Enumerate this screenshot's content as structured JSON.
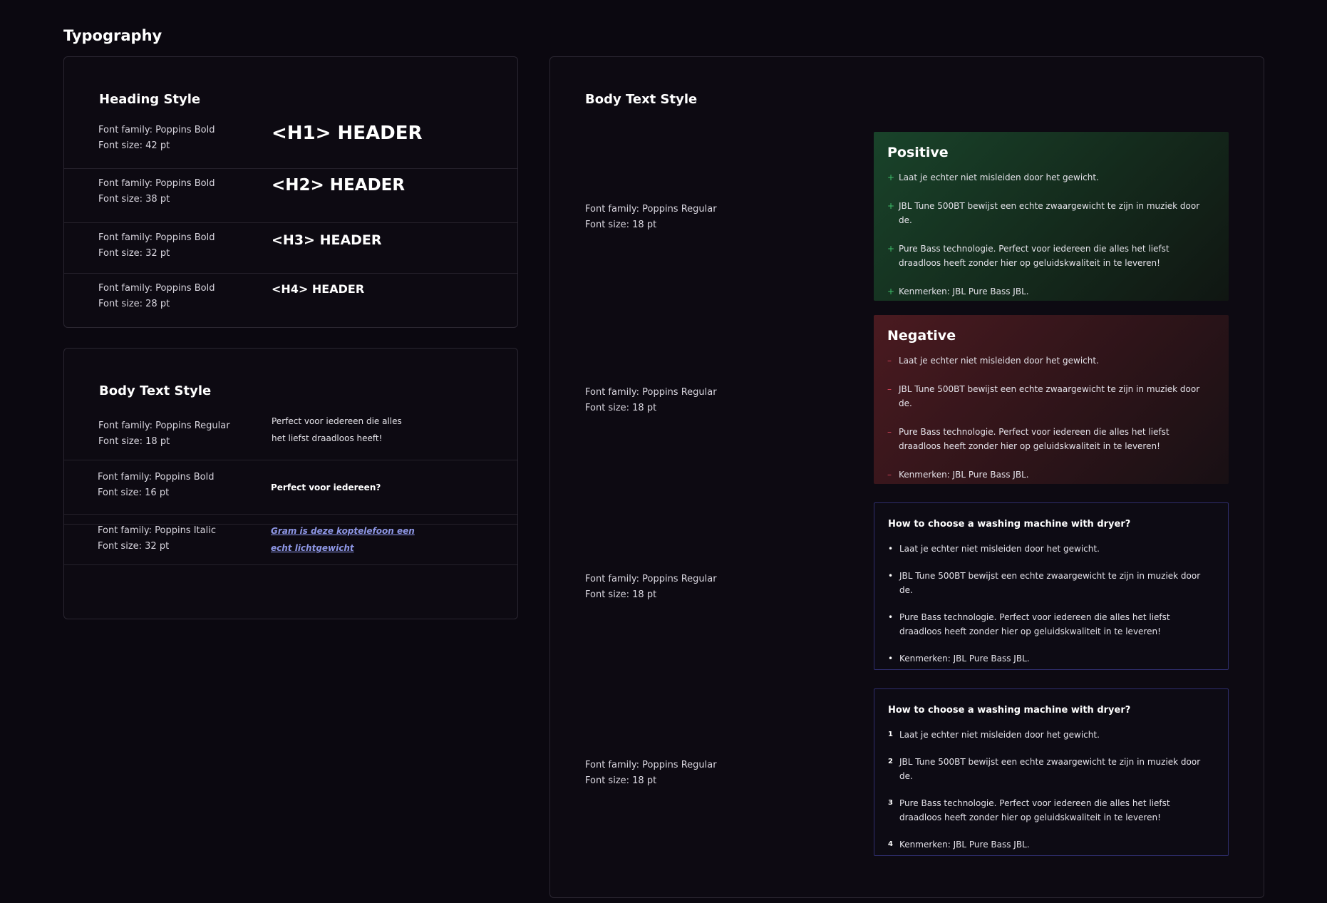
{
  "page": {
    "title": "Typography"
  },
  "heading_panel": {
    "title": "Heading Style",
    "rows": [
      {
        "family": "Font family: Poppins Bold",
        "size": "Font size: 42 pt",
        "sample": "<H1> HEADER"
      },
      {
        "family": "Font family: Poppins Bold",
        "size": "Font size: 38 pt",
        "sample": "<H2> HEADER"
      },
      {
        "family": "Font family: Poppins Bold",
        "size": "Font size: 32 pt",
        "sample": "<H3> HEADER"
      },
      {
        "family": "Font family: Poppins Bold",
        "size": "Font size: 28 pt",
        "sample": "<H4> HEADER"
      }
    ]
  },
  "body_panel": {
    "title": "Body Text Style",
    "rows": [
      {
        "family": "Font family: Poppins Regular",
        "size": "Font size: 18 pt",
        "sample_line1": "Perfect voor iedereen die alles",
        "sample_line2": "het liefst draadloos heeft!"
      },
      {
        "family": "Font family: Poppins Bold",
        "size": "Font size: 16 pt",
        "sample": "Perfect voor iedereen?"
      },
      {
        "family": "Font family: Poppins Italic",
        "size": "Font size: 32 pt",
        "sample_line1": "Gram is deze koptelefoon een",
        "sample_line2": "echt lichtgewicht"
      }
    ]
  },
  "right_panel": {
    "title": "Body Text Style",
    "sections": [
      {
        "family": "Font family: Poppins Regular",
        "size": "Font size: 18 pt",
        "card_title": "Positive",
        "items": [
          "Laat je echter niet misleiden door het gewicht.",
          "JBL Tune 500BT bewijst een echte zwaargewicht te zijn in muziek door de.",
          "Pure Bass technologie. Perfect voor iedereen die alles het liefst draadloos heeft zonder hier op geluidskwaliteit in te leveren!",
          "Kenmerken: JBL Pure Bass JBL."
        ],
        "marker": "+"
      },
      {
        "family": "Font family: Poppins Regular",
        "size": "Font size: 18 pt",
        "card_title": "Negative",
        "items": [
          "Laat je echter niet misleiden door het gewicht.",
          "JBL Tune 500BT bewijst een echte zwaargewicht te zijn in muziek door de.",
          "Pure Bass technologie. Perfect voor iedereen die alles het liefst draadloos heeft zonder hier op geluidskwaliteit in te leveren!",
          "Kenmerken: JBL Pure Bass JBL."
        ],
        "marker": "–"
      },
      {
        "family": "Font family: Poppins Regular",
        "size": "Font size: 18 pt",
        "card_title": "How to choose a washing machine with dryer?",
        "items": [
          "Laat je echter niet misleiden door het gewicht.",
          "JBL Tune 500BT bewijst een echte zwaargewicht te zijn in muziek door de.",
          "Pure Bass technologie. Perfect voor iedereen die alles het liefst draadloos heeft zonder hier op geluidskwaliteit in te leveren!",
          "Kenmerken: JBL Pure Bass JBL."
        ],
        "marker": "•"
      },
      {
        "family": "Font family: Poppins Regular",
        "size": "Font size: 18 pt",
        "card_title": "How to choose a washing machine with dryer?",
        "items": [
          "Laat je echter niet misleiden door het gewicht.",
          "JBL Tune 500BT bewijst een echte zwaargewicht te zijn in muziek door de.",
          "Pure Bass technologie. Perfect voor iedereen die alles het liefst draadloos heeft zonder hier op geluidskwaliteit in te leveren!",
          "Kenmerken: JBL Pure Bass JBL."
        ],
        "numbers": [
          "1",
          "2",
          "3",
          "4"
        ]
      }
    ]
  },
  "colors": {
    "background": "#0b0810",
    "positive_accent": "#3fbf6a",
    "negative_accent": "#d8455a",
    "link": "#8e97e6",
    "info_border": "#2f2e6e"
  }
}
